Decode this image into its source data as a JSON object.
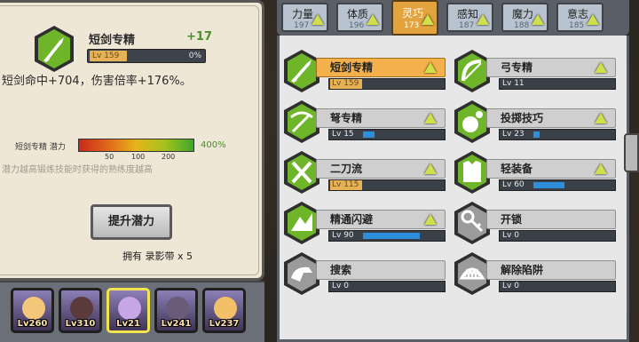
{
  "colors": {
    "accent_orange": "#e3a33d",
    "bonus_green": "#4a8f2c",
    "hex_green": "#6fb52a",
    "hex_grey": "#9b9b9b",
    "progress_blue": "#2d8fdc"
  },
  "detail": {
    "skill_name": "短剑专精",
    "bonus": "+17",
    "level": "Lv 159",
    "progress": "0%",
    "description": "短剑命中+704，伤害倍率+176%。",
    "potential_label": "短剑专精 潜力",
    "potential_ticks": [
      "50",
      "100",
      "200"
    ],
    "potential_value": "400%",
    "potential_note": "潜力越高锻炼技能时获得的熟练度越高",
    "upgrade_button": "提升潜力",
    "own_text": "拥有 录影带 x 5"
  },
  "characters": [
    {
      "level": "Lv260",
      "selected": false
    },
    {
      "level": "Lv310",
      "selected": false
    },
    {
      "level": "Lv21",
      "selected": true
    },
    {
      "level": "Lv241",
      "selected": false
    },
    {
      "level": "Lv237",
      "selected": false
    }
  ],
  "tabs": [
    {
      "name": "力量",
      "value": "197"
    },
    {
      "name": "体质",
      "value": "196"
    },
    {
      "name": "灵巧",
      "value": "173",
      "active": true
    },
    {
      "name": "感知",
      "value": "187"
    },
    {
      "name": "魔力",
      "value": "188"
    },
    {
      "name": "意志",
      "value": "185"
    }
  ],
  "skills": [
    {
      "name": "短剑专精",
      "level": "Lv 159",
      "icon": "dagger-icon",
      "fill": 0,
      "selected": true
    },
    {
      "name": "弓专精",
      "level": "Lv 11",
      "icon": "bow-icon",
      "fill": 0
    },
    {
      "name": "弩专精",
      "level": "Lv 15",
      "icon": "crossbow-icon",
      "fill": 0.14
    },
    {
      "name": "投掷技巧",
      "level": "Lv 23",
      "icon": "bomb-icon",
      "fill": 0.08
    },
    {
      "name": "二刀流",
      "level": "Lv 115",
      "icon": "dual-blade-icon",
      "fill": 0
    },
    {
      "name": "轻装备",
      "level": "Lv 60",
      "icon": "light-armor-icon",
      "fill": 0.38
    },
    {
      "name": "精通闪避",
      "level": "Lv 90",
      "icon": "evasion-icon",
      "fill": 0.7
    },
    {
      "name": "开锁",
      "level": "Lv 0",
      "icon": "key-icon",
      "fill": 0
    },
    {
      "name": "搜索",
      "level": "Lv 0",
      "icon": "search-icon",
      "fill": 0
    },
    {
      "name": "解除陷阱",
      "level": "Lv 0",
      "icon": "trap-icon",
      "fill": 0
    }
  ]
}
